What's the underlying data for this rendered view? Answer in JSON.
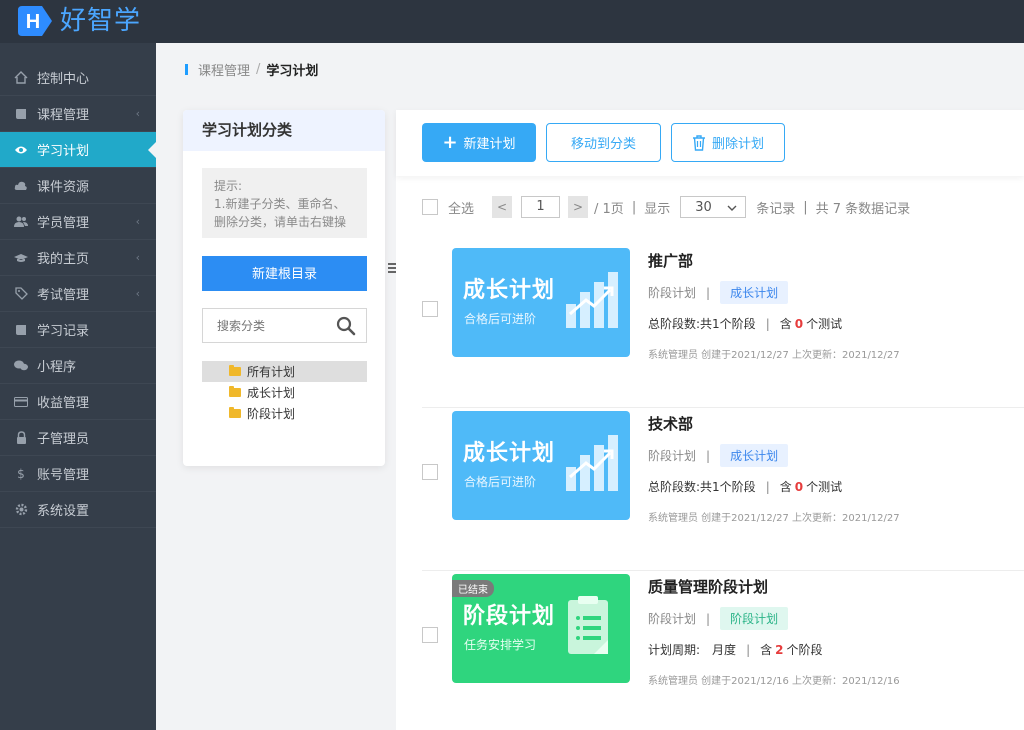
{
  "app": {
    "name": "好智学",
    "logo_letter": "H"
  },
  "sidebar": {
    "items": [
      {
        "label": "控制中心",
        "icon": "home-icon",
        "chevron": false
      },
      {
        "label": "课程管理",
        "icon": "book-icon",
        "chevron": true
      },
      {
        "label": "学习计划",
        "icon": "eye-icon",
        "chevron": false,
        "active": true
      },
      {
        "label": "课件资源",
        "icon": "cloud-icon",
        "chevron": false
      },
      {
        "label": "学员管理",
        "icon": "users-icon",
        "chevron": true
      },
      {
        "label": "我的主页",
        "icon": "graduation-cap-icon",
        "chevron": true
      },
      {
        "label": "考试管理",
        "icon": "tag-icon",
        "chevron": true
      },
      {
        "label": "学习记录",
        "icon": "book-icon",
        "chevron": false
      },
      {
        "label": "小程序",
        "icon": "chat-icon",
        "chevron": false
      },
      {
        "label": "收益管理",
        "icon": "card-icon",
        "chevron": false
      },
      {
        "label": "子管理员",
        "icon": "lock-icon",
        "chevron": false
      },
      {
        "label": "账号管理",
        "icon": "dollar-icon",
        "chevron": false
      },
      {
        "label": "系统设置",
        "icon": "gear-icon",
        "chevron": false
      }
    ]
  },
  "breadcrumb": {
    "parent": "课程管理",
    "separator": "/",
    "current": "学习计划"
  },
  "category_panel": {
    "title": "学习计划分类",
    "tip_line1": "提示:",
    "tip_line2": "1.新建子分类、重命名、删除分类，请单击右键操",
    "new_root_label": "新建根目录",
    "search_placeholder": "搜索分类",
    "tree": [
      {
        "label": "所有计划",
        "selected": true
      },
      {
        "label": "成长计划",
        "selected": false
      },
      {
        "label": "阶段计划",
        "selected": false
      }
    ]
  },
  "toolbar": {
    "new_plan": "新建计划",
    "move_to_category": "移动到分类",
    "delete_plan": "删除计划"
  },
  "pager": {
    "select_all": "全选",
    "prev": "<",
    "page": "1",
    "next": ">",
    "page_total": "/ 1页",
    "sep": "|",
    "show": "显示",
    "page_size": "30",
    "records_unit": "条记录",
    "total_text": "共 7 条数据记录"
  },
  "plans": [
    {
      "name": "推广部",
      "type": "阶段计划",
      "category": "成长计划",
      "thumb_title": "成长计划",
      "thumb_sub": "合格后可进阶",
      "stat_a_label": "总阶段数:",
      "stat_a_value": "共1个阶段",
      "stat_b_prefix": "含",
      "stat_b_count": "0",
      "stat_b_suffix": "个测试",
      "footer": "系统管理员 创建于2021/12/27 上次更新：2021/12/27"
    },
    {
      "name": "技术部",
      "type": "阶段计划",
      "category": "成长计划",
      "thumb_title": "成长计划",
      "thumb_sub": "合格后可进阶",
      "stat_a_label": "总阶段数:",
      "stat_a_value": "共1个阶段",
      "stat_b_prefix": "含",
      "stat_b_count": "0",
      "stat_b_suffix": "个测试",
      "footer": "系统管理员 创建于2021/12/27 上次更新：2021/12/27"
    },
    {
      "name": "质量管理阶段计划",
      "type": "阶段计划",
      "category": "阶段计划",
      "thumb_title": "阶段计划",
      "thumb_sub": "任务安排学习",
      "thumb_badge": "已结束",
      "stat_a_label": "计划周期:",
      "stat_a_value": "月度",
      "stat_b_prefix": "含",
      "stat_b_count": "2",
      "stat_b_suffix": "个阶段",
      "footer": "系统管理员 创建于2021/12/16 上次更新：2021/12/16"
    }
  ],
  "colors": {
    "topbar": "#2d3540",
    "sidebar": "#353e4a",
    "active": "#21a9c9",
    "primary": "#36a9f5",
    "blue_thumb": "#4fbaf8",
    "green_thumb": "#2fd57e"
  }
}
